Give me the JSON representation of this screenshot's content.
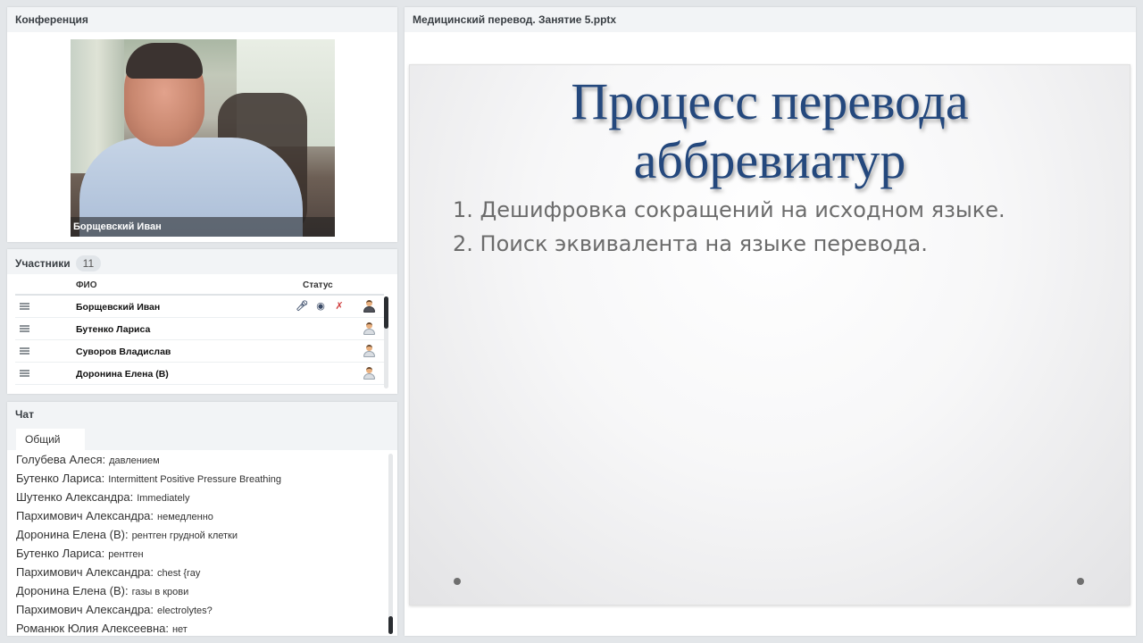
{
  "conference": {
    "title": "Конференция",
    "video_name": "Борщевский Иван"
  },
  "participants": {
    "title": "Участники",
    "count": "11",
    "col_name": "ФИО",
    "col_status": "Статус",
    "rows": [
      {
        "name": "Борщевский Иван",
        "icons": [
          "mic-icon",
          "webcam-icon",
          "screen-off-icon",
          "presenter-icon"
        ]
      },
      {
        "name": "Бутенко Лариса",
        "icons": [
          "user-icon"
        ]
      },
      {
        "name": "Суворов Владислав",
        "icons": [
          "user-icon"
        ]
      },
      {
        "name": "Доронина Елена (В)",
        "icons": [
          "user-icon"
        ]
      }
    ]
  },
  "chat": {
    "title": "Чат",
    "tab": "Общий",
    "messages": [
      {
        "author": "Голубева Алеся:",
        "text": "давлением"
      },
      {
        "author": "Бутенко Лариса:",
        "text": "Intermittent Positive Pressure Breathing"
      },
      {
        "author": "Шутенко Александра:",
        "text": "Immediately"
      },
      {
        "author": "Пархимович Александра:",
        "text": "немедленно"
      },
      {
        "author": "Доронина Елена (В):",
        "text": "рентген грудной клетки"
      },
      {
        "author": "Бутенко Лариса:",
        "text": "рентген"
      },
      {
        "author": "Пархимович Александра:",
        "text": "chest {ray"
      },
      {
        "author": "Доронина Елена (В):",
        "text": "газы в крови"
      },
      {
        "author": "Пархимович Александра:",
        "text": "electrolytes?"
      },
      {
        "author": "Романюк Юлия Алексеевна:",
        "text": "нет"
      }
    ]
  },
  "presentation": {
    "file_title": "Медицинский перевод. Занятие 5.pptx",
    "slide": {
      "title_line1": "Процесс перевода",
      "title_line2": "аббревиатур",
      "items": [
        "1. Дешифровка сокращений на исходном языке.",
        "2. Поиск эквивалента на языке перевода."
      ]
    }
  },
  "colors": {
    "slide_title": "#24487d",
    "panel_header_bg": "#f2f4f6",
    "background": "#e3e6e9"
  }
}
